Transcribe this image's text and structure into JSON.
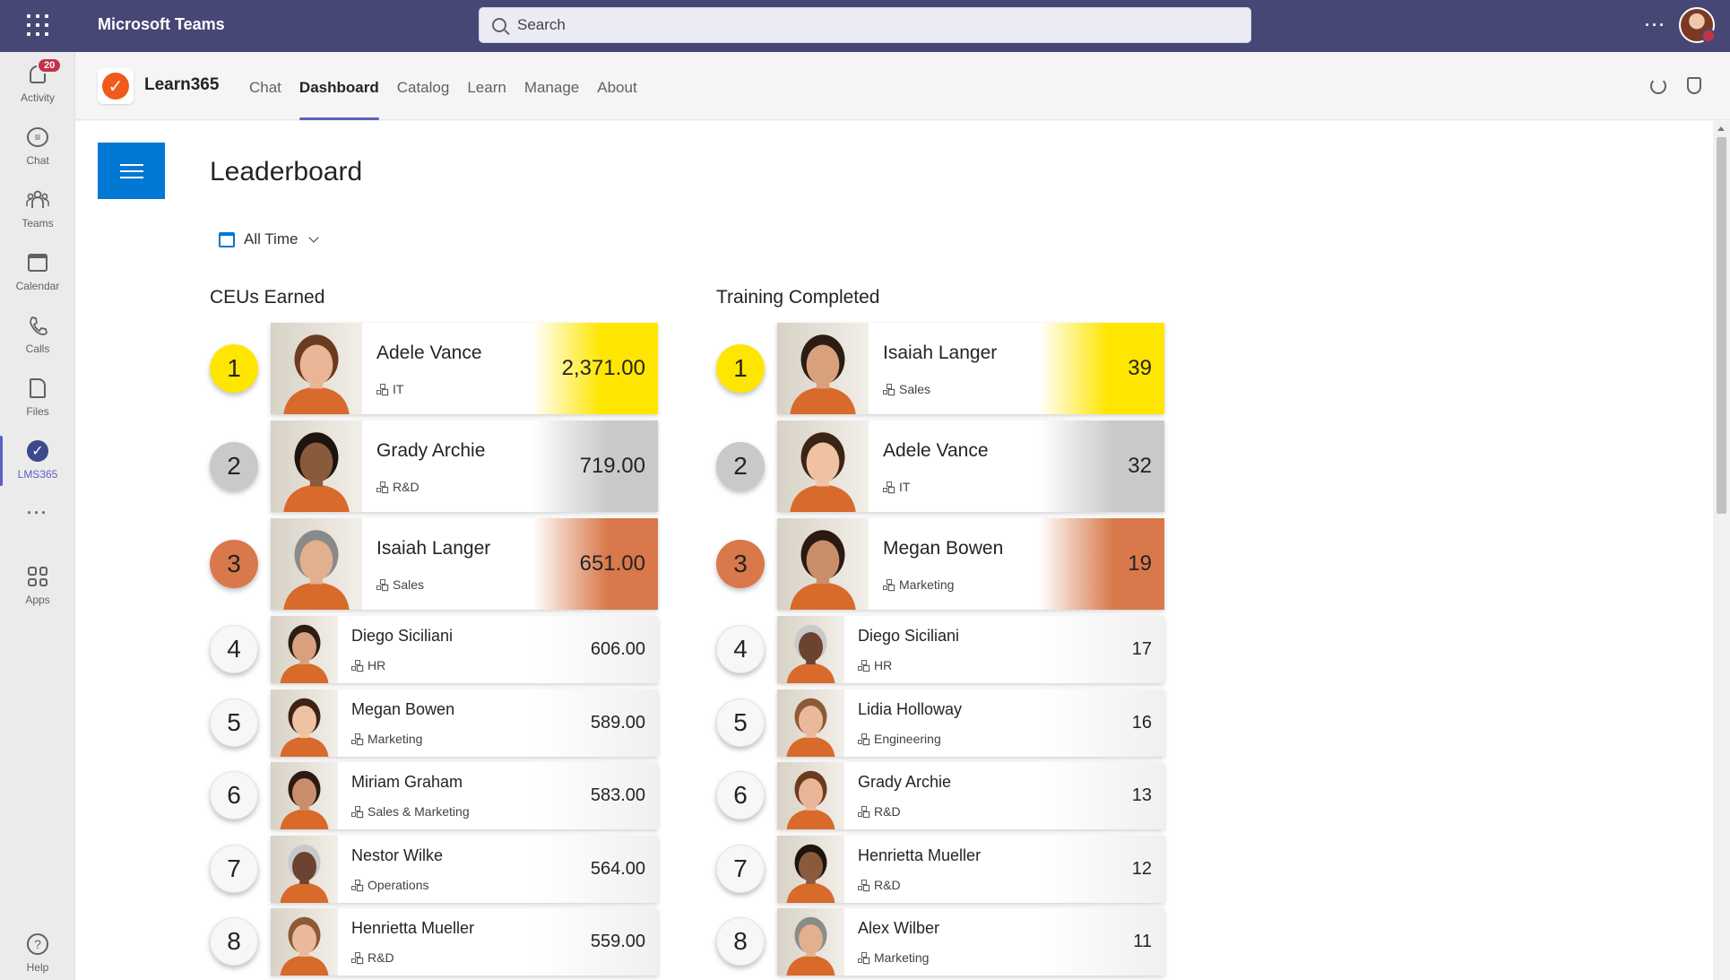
{
  "topbar": {
    "app_name": "Microsoft Teams",
    "search_placeholder": "Search",
    "more": "···"
  },
  "rail": {
    "activity": {
      "label": "Activity",
      "badge": "20"
    },
    "chat": "Chat",
    "teams": "Teams",
    "calendar": "Calendar",
    "calls": "Calls",
    "files": "Files",
    "lms": "LMS365",
    "more": "···",
    "apps": "Apps",
    "help": "Help"
  },
  "app": {
    "name": "Learn365",
    "tabs": [
      "Chat",
      "Dashboard",
      "Catalog",
      "Learn",
      "Manage",
      "About"
    ],
    "active_tab": "Dashboard"
  },
  "page": {
    "title": "Leaderboard",
    "filter": "All Time"
  },
  "colors": {
    "gold": "#ffe600",
    "silver": "#c9c9c9",
    "bronze": "#d9784a",
    "brand": "#464775",
    "accent": "#0078d4"
  },
  "boards": [
    {
      "title": "CEUs Earned",
      "entries": [
        {
          "rank": "1",
          "name": "Adele Vance",
          "dept": "IT",
          "score": "2,371.00"
        },
        {
          "rank": "2",
          "name": "Grady Archie",
          "dept": "R&D",
          "score": "719.00"
        },
        {
          "rank": "3",
          "name": "Isaiah Langer",
          "dept": "Sales",
          "score": "651.00"
        },
        {
          "rank": "4",
          "name": "Diego Siciliani",
          "dept": "HR",
          "score": "606.00"
        },
        {
          "rank": "5",
          "name": "Megan Bowen",
          "dept": "Marketing",
          "score": "589.00"
        },
        {
          "rank": "6",
          "name": "Miriam Graham",
          "dept": "Sales & Marketing",
          "score": "583.00"
        },
        {
          "rank": "7",
          "name": "Nestor Wilke",
          "dept": "Operations",
          "score": "564.00"
        },
        {
          "rank": "8",
          "name": "Henrietta Mueller",
          "dept": "R&D",
          "score": "559.00"
        }
      ]
    },
    {
      "title": "Training Completed",
      "entries": [
        {
          "rank": "1",
          "name": "Isaiah Langer",
          "dept": "Sales",
          "score": "39"
        },
        {
          "rank": "2",
          "name": "Adele Vance",
          "dept": "IT",
          "score": "32"
        },
        {
          "rank": "3",
          "name": "Megan Bowen",
          "dept": "Marketing",
          "score": "19"
        },
        {
          "rank": "4",
          "name": "Diego Siciliani",
          "dept": "HR",
          "score": "17"
        },
        {
          "rank": "5",
          "name": "Lidia Holloway",
          "dept": "Engineering",
          "score": "16"
        },
        {
          "rank": "6",
          "name": "Grady Archie",
          "dept": "R&D",
          "score": "13"
        },
        {
          "rank": "7",
          "name": "Henrietta Mueller",
          "dept": "R&D",
          "score": "12"
        },
        {
          "rank": "8",
          "name": "Alex Wilber",
          "dept": "Marketing",
          "score": "11"
        }
      ]
    }
  ]
}
